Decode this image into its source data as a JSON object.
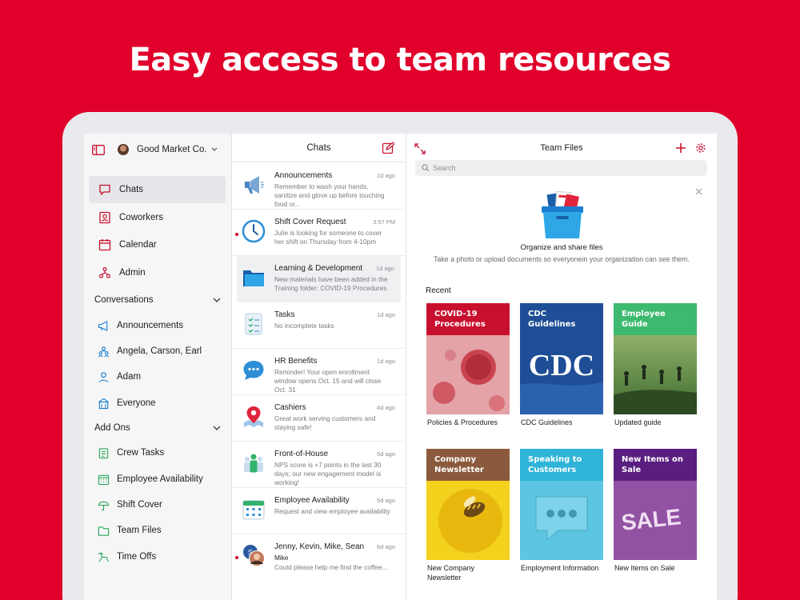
{
  "headline": "Easy access to team resources",
  "sidebar": {
    "org_name": "Good Market Co.",
    "nav": [
      "Chats",
      "Coworkers",
      "Calendar",
      "Admin"
    ],
    "conversations_label": "Conversations",
    "conversations": [
      "Announcements",
      "Angela, Carson, Earl",
      "Adam",
      "Everyone"
    ],
    "addons_label": "Add Ons",
    "addons": [
      "Crew Tasks",
      "Employee Availability",
      "Shift Cover",
      "Team Files",
      "Time Offs"
    ]
  },
  "chats": {
    "title": "Chats",
    "items": [
      {
        "title": "Announcements",
        "time": "1d ago",
        "preview": "Remember to wash your hands, sanitize and glove up before touching food or..."
      },
      {
        "title": "Shift Cover Request",
        "time": "3:57 PM",
        "preview": "Julie is looking for someone to cover her shift on Thursday from 4-10pm"
      },
      {
        "title": "Learning & Development",
        "time": "1d ago",
        "preview": "New materials have been added in the Training folder: COVID-19 Procedures"
      },
      {
        "title": "Tasks",
        "time": "1d ago",
        "preview": "No incomplete tasks"
      },
      {
        "title": "HR Benefits",
        "time": "1d ago",
        "preview": "Reminder! Your open enrollment window opens Oct. 15 and will close Oct. 31"
      },
      {
        "title": "Cashiers",
        "time": "4d ago",
        "preview": "Great work serving customers and staying safe!"
      },
      {
        "title": "Front-of-House",
        "time": "5d ago",
        "preview": "NPS score is +7 points in the last 30 days; our new engagement model is working!"
      },
      {
        "title": "Employee Availability",
        "time": "5d ago",
        "preview": "Request and view employee availability"
      },
      {
        "title": "Jenny, Kevin, Mike, Sean",
        "time": "6d ago",
        "sender": "Mike",
        "preview": "Could please help me find the coffee..."
      }
    ]
  },
  "files": {
    "title": "Team Files",
    "search_placeholder": "Search",
    "empty_title": "Organize and share files",
    "empty_sub": "Take a photo or upload documents so everyonein your organization can see them.",
    "recent_label": "Recent",
    "cards": [
      {
        "band": "COVID-19 Procedures",
        "caption": "Policies & Procedures",
        "color": "#c8102e"
      },
      {
        "band": "CDC Guidelines",
        "caption": "CDC Guidelines",
        "color": "#1f4e96",
        "art_text": "CDC"
      },
      {
        "band": "Employee Guide",
        "caption": "Updated guide",
        "color": "#3dba6f"
      },
      {
        "band": "Company Newsletter",
        "caption": "New Company Newsletter",
        "color": "#8b5a3c"
      },
      {
        "band": "Speaking to Customers",
        "caption": "Employment Information",
        "color": "#2fb4d8"
      },
      {
        "band": "New Items on Sale",
        "caption": "New Items on Sale",
        "color": "#5a1e80",
        "art_text": "SALE"
      }
    ]
  }
}
